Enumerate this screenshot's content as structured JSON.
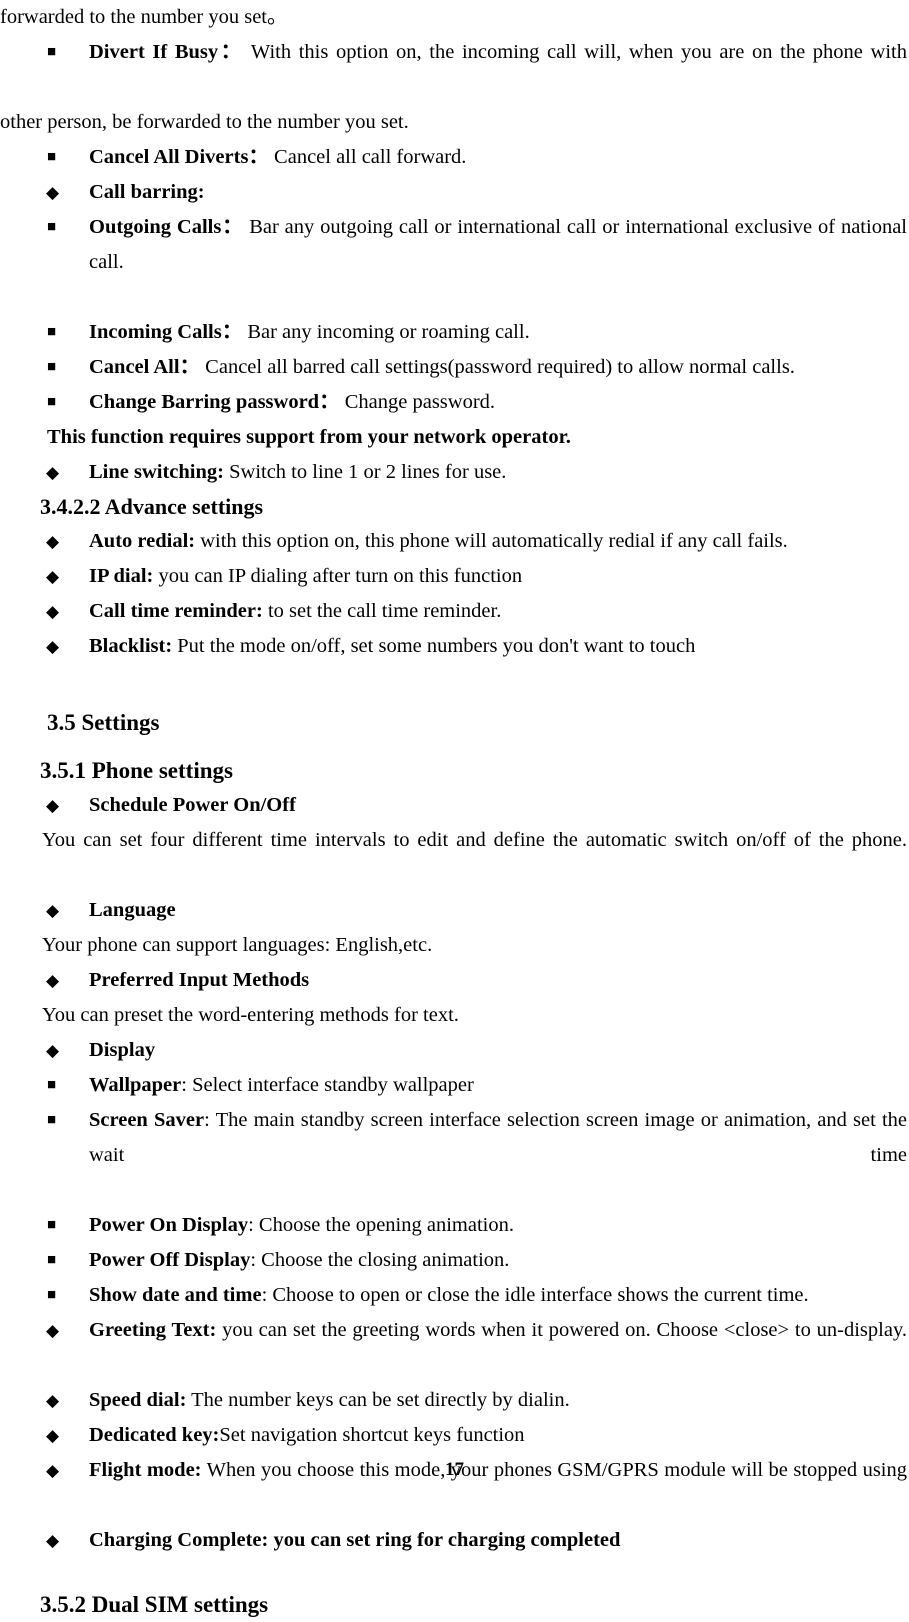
{
  "document": {
    "page_number": "17",
    "bullets": {
      "square": "■",
      "diamond": "◆"
    }
  },
  "content": {
    "intro_continuation": "forwarded to the number you set。",
    "divert_if_busy": {
      "term": "Divert If Busy：",
      "rest": "  With this option on, the incoming call will, when you are on the phone with"
    },
    "divert_if_busy_cont": "other person, be forwarded to the number you set.",
    "cancel_all_diverts": {
      "term": "Cancel All Diverts：",
      "rest": "  Cancel all call forward."
    },
    "call_barring": {
      "term": "Call barring:",
      "rest": ""
    },
    "outgoing_calls": {
      "term": "Outgoing Calls：",
      "rest": " Bar any outgoing call or international call or international exclusive of national call."
    },
    "incoming_calls": {
      "term": "Incoming Calls：",
      "rest": " Bar any incoming or roaming call."
    },
    "cancel_all": {
      "term": "Cancel All：",
      "rest": "  Cancel all barred call settings(password required) to allow normal calls."
    },
    "change_barring_password": {
      "term": "Change Barring password：",
      "rest": "  Change password."
    },
    "network_operator_note": "This function requires support from your network operator.",
    "line_switching": {
      "term": "Line switching:",
      "rest": " Switch to line 1 or 2 lines for use."
    },
    "heading_advance_settings": "3.4.2.2 Advance settings",
    "auto_redial": {
      "term": "Auto redial:",
      "rest": " with this option on, this phone will automatically redial if any call fails."
    },
    "ip_dial": {
      "term": "IP dial:",
      "rest": " you can IP dialing after turn on this function"
    },
    "call_time_reminder": {
      "term": "Call time reminder:",
      "rest": " to set the call time reminder."
    },
    "blacklist": {
      "term": "Blacklist:",
      "rest": " Put the mode on/off, set some numbers you don't want to touch"
    },
    "heading_settings": "3.5 Settings",
    "heading_phone_settings": "3.5.1 Phone settings",
    "schedule_power": {
      "term": "Schedule Power On/Off",
      "rest": ""
    },
    "schedule_power_desc": "You can set four different time intervals to edit and define the automatic switch on/off of the phone.",
    "language": {
      "term": "Language",
      "rest": ""
    },
    "language_desc": "Your phone can support languages: English,etc.",
    "preferred_input_methods": {
      "term": "Preferred Input Methods",
      "rest": ""
    },
    "preferred_input_desc": "You can preset the word-entering methods for text.",
    "display": {
      "term": "Display",
      "rest": ""
    },
    "wallpaper": {
      "term": "Wallpaper",
      "rest": ": Select interface standby wallpaper"
    },
    "screen_saver": {
      "term": "Screen Saver",
      "rest": ": The main standby screen interface selection screen image or animation, and set the wait time"
    },
    "power_on_display": {
      "term": "Power On Display",
      "rest": ": Choose the opening animation."
    },
    "power_off_display": {
      "term": "Power Off Display",
      "rest": ": Choose the closing animation."
    },
    "show_date_and_time": {
      "term": "Show date and time",
      "rest": ": Choose to open or close the idle interface shows the current time."
    },
    "greeting_text": {
      "term": "Greeting Text:",
      "rest": " you can set the greeting words when it powered on. Choose <close> to un-display."
    },
    "speed_dial": {
      "term": "Speed dial:",
      "rest": " The number keys can be set directly by dialin."
    },
    "dedicated_key": {
      "term": "Dedicated key:",
      "rest": "Set navigation shortcut keys function"
    },
    "flight_mode": {
      "term": "Flight mode:",
      "rest": " When you choose this mode,  your phones GSM/GPRS module will be stopped using"
    },
    "charging_complete": {
      "term": "Charging Complete:",
      "rest": " you can set ring for charging completed"
    },
    "heading_dual_sim": "3.5.2 Dual SIM settings"
  }
}
